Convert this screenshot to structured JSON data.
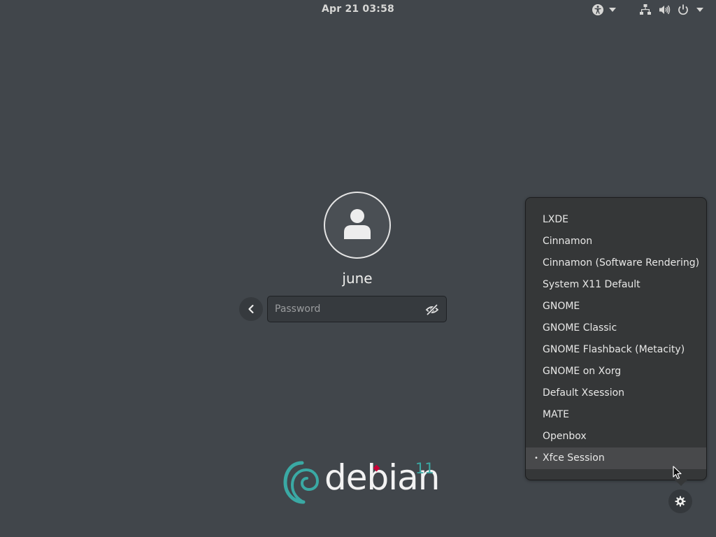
{
  "topbar": {
    "clock": "Apr 21  03:58",
    "icons": [
      "accessibility-icon",
      "dropdown-caret-icon",
      "network-icon",
      "volume-icon",
      "power-icon",
      "dropdown-caret-icon"
    ]
  },
  "login": {
    "username": "june",
    "password_placeholder": "Password",
    "back_icon": "chevron-left-icon",
    "reveal_icon": "eye-slash-icon"
  },
  "session_menu": {
    "items": [
      {
        "label": "LXDE",
        "selected": false
      },
      {
        "label": "Cinnamon",
        "selected": false
      },
      {
        "label": "Cinnamon (Software Rendering)",
        "selected": false
      },
      {
        "label": "System X11 Default",
        "selected": false
      },
      {
        "label": "GNOME",
        "selected": false
      },
      {
        "label": "GNOME Classic",
        "selected": false
      },
      {
        "label": "GNOME Flashback (Metacity)",
        "selected": false
      },
      {
        "label": "GNOME on Xorg",
        "selected": false
      },
      {
        "label": "Default Xsession",
        "selected": false
      },
      {
        "label": "MATE",
        "selected": false
      },
      {
        "label": "Openbox",
        "selected": false
      },
      {
        "label": "Xfce Session",
        "selected": true
      }
    ],
    "selected_marker": "•"
  },
  "settings_button": {
    "icon": "gear-icon"
  },
  "branding": {
    "name": "debian",
    "version": "11"
  },
  "colors": {
    "background": "#41464b",
    "menu_background": "#353738",
    "menu_selected": "#48494b",
    "debian_teal": "#3aa9a4",
    "debian_red": "#c70036"
  }
}
